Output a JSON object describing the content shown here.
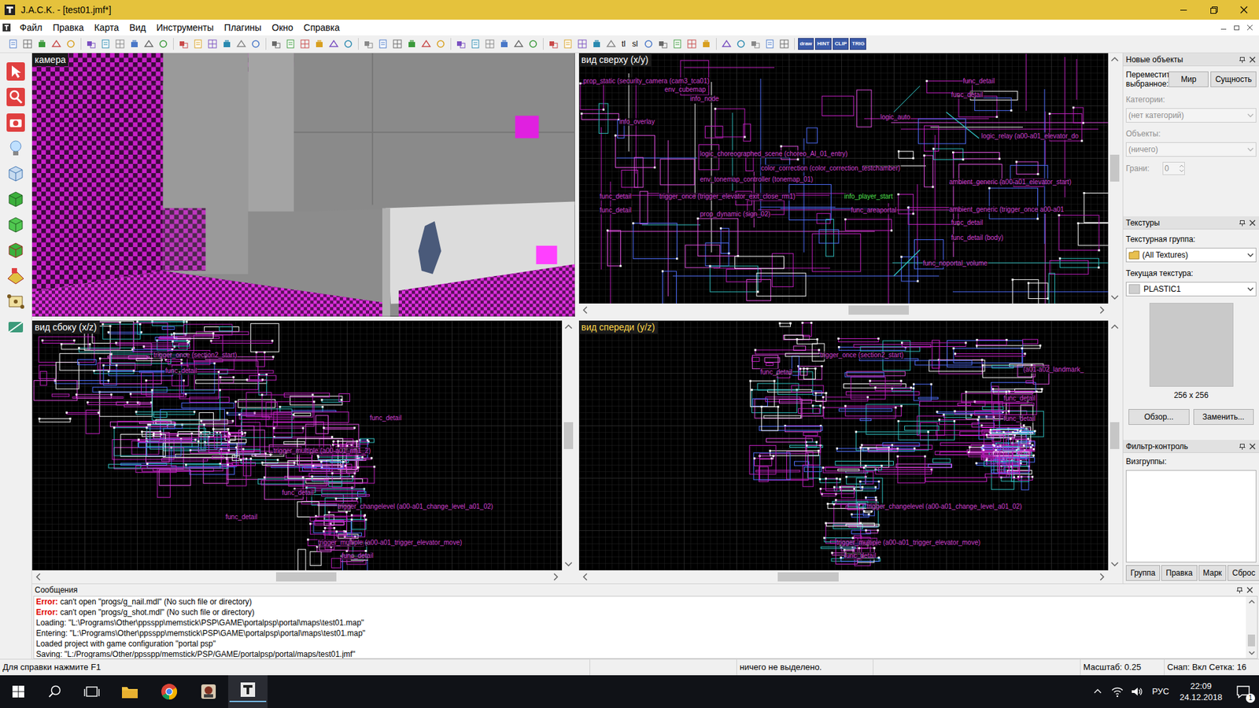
{
  "window": {
    "title": "J.A.C.K. - [test01.jmf*]"
  },
  "menu": [
    "Файл",
    "Правка",
    "Карта",
    "Вид",
    "Инструменты",
    "Плагины",
    "Окно",
    "Справка"
  ],
  "toolbar": {
    "text_buttons": [
      "tl",
      "sl"
    ],
    "mode_buttons": [
      "draw",
      "HINT",
      "CLIP",
      "TRIG"
    ]
  },
  "viewports": [
    {
      "title": "камера",
      "kind": "camera",
      "active": false
    },
    {
      "title": "вид сверху (x/y)",
      "kind": "top",
      "active": false,
      "scroll": {
        "h": 0.58,
        "v": 0.45
      }
    },
    {
      "title": "вид сбоку (x/z)",
      "kind": "side",
      "active": false,
      "scroll": {
        "h": 0.52,
        "v": 0.45
      }
    },
    {
      "title": "вид спереди (y/z)",
      "kind": "front",
      "active": true,
      "scroll": {
        "h": 0.42,
        "v": 0.45
      }
    }
  ],
  "labels": {
    "top": [
      {
        "text": "prop_static (security_camera (cam3_tca01)",
        "color": "#d040d0"
      },
      {
        "text": "env_cubemap",
        "color": "#d040d0"
      },
      {
        "text": "info_node",
        "color": "#d040d0"
      },
      {
        "text": "info_overlay",
        "color": "#d040d0"
      },
      {
        "text": "logic_auto",
        "color": "#d040d0"
      },
      {
        "text": "func_detail",
        "color": "#d040d0"
      },
      {
        "text": "func_detail",
        "color": "#d040d0"
      },
      {
        "text": "logic_relay (a00-a01_elevator_do",
        "color": "#d040d0"
      },
      {
        "text": "logic_choreographed_scene (choreo_AI_01_entry)",
        "color": "#d040d0"
      },
      {
        "text": "color_correction (color_correction_testchamber)",
        "color": "#d040d0"
      },
      {
        "text": "env_tonemap_controller (tonemap_01)",
        "color": "#d040d0"
      },
      {
        "text": "ambient_generic (a00-a01_elevator_start)",
        "color": "#d040d0"
      },
      {
        "text": "func_detail",
        "color": "#d040d0"
      },
      {
        "text": "trigger_once (trigger_elevator_exit_close_rm1)",
        "color": "#d040d0"
      },
      {
        "text": "info_player_start",
        "color": "#50e050"
      },
      {
        "text": "func_detail",
        "color": "#d040d0"
      },
      {
        "text": "prop_dynamic (sign_02)",
        "color": "#d040d0"
      },
      {
        "text": "func_areaportal",
        "color": "#d040d0"
      },
      {
        "text": "ambient_generic (trigger_once a00-a01",
        "color": "#d040d0"
      },
      {
        "text": "func_detail",
        "color": "#d040d0"
      },
      {
        "text": "func_detail (body)",
        "color": "#d040d0"
      },
      {
        "text": "func_noportal_volume",
        "color": "#d040d0"
      }
    ],
    "side": [
      {
        "text": "trigger_once (section2_start)",
        "color": "#d040d0"
      },
      {
        "text": "func_detail",
        "color": "#d040d0"
      },
      {
        "text": "func_detail",
        "color": "#d040d0"
      },
      {
        "text": "trigger_multiple (a00-a01_rm1_2)",
        "color": "#d040d0"
      },
      {
        "text": "func_detail",
        "color": "#d040d0"
      },
      {
        "text": "trigger_changelevel (a00-a01_change_level_a01_02)",
        "color": "#d040d0"
      },
      {
        "text": "func_detail",
        "color": "#d040d0"
      },
      {
        "text": "trigger_multiple (a00-a01_trigger_elevator_move)",
        "color": "#d040d0"
      },
      {
        "text": "func_detail",
        "color": "#d040d0"
      }
    ],
    "front": [
      {
        "text": "trigger_once (section2_start)",
        "color": "#d040d0"
      },
      {
        "text": "(a01-a02_landmark_",
        "color": "#d040d0"
      },
      {
        "text": "func_detail",
        "color": "#d040d0"
      },
      {
        "text": "func_detail",
        "color": "#d040d0"
      },
      {
        "text": "func_detail",
        "color": "#d040d0"
      },
      {
        "text": "trigger_changelevel (a00-a01_change_level_a01_02)",
        "color": "#d040d0"
      },
      {
        "text": "trigger_multiple (a00-a01_trigger_elevator_move)",
        "color": "#d040d0"
      },
      {
        "text": "func_detail",
        "color": "#d040d0"
      }
    ]
  },
  "new_objects": {
    "title": "Новые объекты",
    "move_label": "Переместить выбранное:",
    "move_buttons": [
      "Мир",
      "Сущность"
    ],
    "categories_label": "Категории:",
    "categories_value": "(нет категорий)",
    "categories_disabled": true,
    "objects_label": "Объекты:",
    "objects_value": "(ничего)",
    "objects_disabled": true,
    "faces_label": "Грани:",
    "faces_value": "0",
    "faces_disabled": true
  },
  "textures": {
    "title": "Текстуры",
    "group_label": "Текстурная группа:",
    "group_value": "(All Textures)",
    "current_label": "Текущая текстура:",
    "current_value": "PLASTIC1",
    "size": "256 x 256",
    "buttons": [
      "Обзор...",
      "Заменить..."
    ]
  },
  "filter": {
    "title": "Фильтр-контроль",
    "visgroups_label": "Визгруппы:",
    "buttons": [
      "Группа",
      "Правка",
      "Марк",
      "Сброс"
    ]
  },
  "messages": {
    "title": "Сообщения",
    "lines": [
      {
        "kind": "error",
        "prefix": "Error:",
        "text": " can't open \"progs/g_nail.mdl\" (No such file or directory)"
      },
      {
        "kind": "error",
        "prefix": "Error:",
        "text": " can't open \"progs/g_shot.mdl\" (No such file or directory)"
      },
      {
        "kind": "info",
        "text": "Loading: \"L:\\Programs\\Other\\ppsspp\\memstick\\PSP\\GAME\\portalpsp\\portal\\maps\\test01.map\""
      },
      {
        "kind": "info",
        "text": "Entering: \"L:\\Programs\\Other\\ppsspp\\memstick\\PSP\\GAME\\portalpsp\\portal\\maps\\test01.map\""
      },
      {
        "kind": "info",
        "text": "Loaded project with game configuration \"portal psp\""
      },
      {
        "kind": "info",
        "text": "Saving: \"L:/Programs/Other/ppsspp/memstick/PSP/GAME/portalpsp/portal/maps/test01.jmf\""
      }
    ]
  },
  "status_bar": [
    "Для справки нажмите F1",
    "ничего не выделено.",
    "Масштаб: 0.25",
    "Снап: Вкл Сетка: 16"
  ],
  "taskbar": {
    "language": "РУС",
    "time": "22:09",
    "date": "24.12.2018",
    "notifications": "1"
  }
}
